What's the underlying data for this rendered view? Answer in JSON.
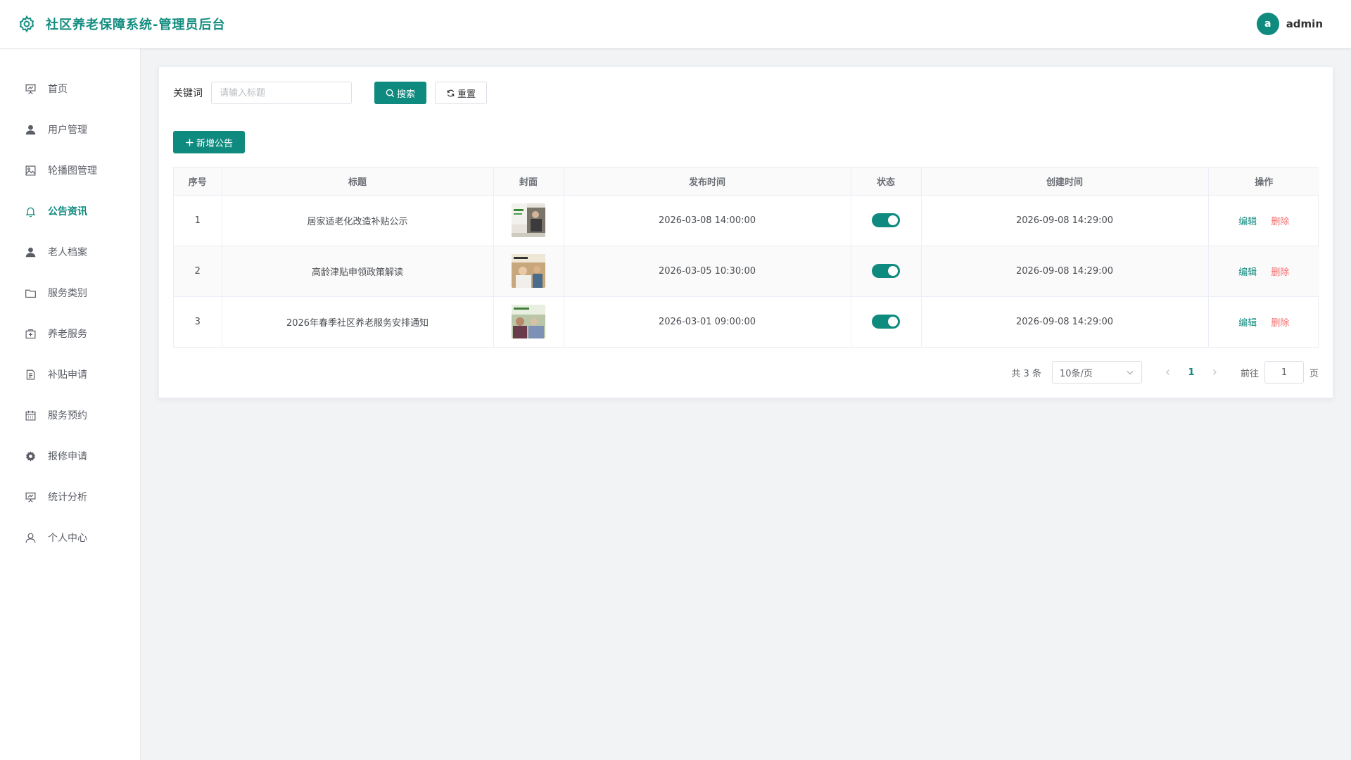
{
  "header": {
    "title": "社区养老保障系统-管理员后台",
    "user": {
      "avatar_letter": "a",
      "name": "admin"
    }
  },
  "sidebar": {
    "items": [
      {
        "label": "首页",
        "icon": "presentation-icon"
      },
      {
        "label": "用户管理",
        "icon": "user-icon"
      },
      {
        "label": "轮播图管理",
        "icon": "picture-icon"
      },
      {
        "label": "公告资讯",
        "icon": "bell-icon",
        "active": true
      },
      {
        "label": "老人档案",
        "icon": "user-icon"
      },
      {
        "label": "服务类别",
        "icon": "folder-icon"
      },
      {
        "label": "养老服务",
        "icon": "first-aid-icon"
      },
      {
        "label": "补贴申请",
        "icon": "document-icon"
      },
      {
        "label": "服务预约",
        "icon": "calendar-icon"
      },
      {
        "label": "报修申请",
        "icon": "gear-icon"
      },
      {
        "label": "统计分析",
        "icon": "presentation-icon"
      },
      {
        "label": "个人中心",
        "icon": "user-outline-icon"
      }
    ]
  },
  "search": {
    "label": "关键词",
    "placeholder": "请输入标题",
    "value": "",
    "search_button": "搜索",
    "reset_button": "重置"
  },
  "add_button": "新增公告",
  "table": {
    "columns": [
      "序号",
      "标题",
      "封面",
      "发布时间",
      "状态",
      "创建时间",
      "操作"
    ],
    "rows": [
      {
        "index": "1",
        "title": "居家适老化改造补贴公示",
        "publish_time": "2026-03-08 14:00:00",
        "status_on": true,
        "created_time": "2026-09-08 14:29:00"
      },
      {
        "index": "2",
        "title": "高龄津贴申领政策解读",
        "publish_time": "2026-03-05 10:30:00",
        "status_on": true,
        "created_time": "2026-09-08 14:29:00"
      },
      {
        "index": "3",
        "title": "2026年春季社区养老服务安排通知",
        "publish_time": "2026-03-01 09:00:00",
        "status_on": true,
        "created_time": "2026-09-08 14:29:00"
      }
    ],
    "actions": {
      "edit": "编辑",
      "delete": "删除"
    }
  },
  "pagination": {
    "total_text": "共 3 条",
    "page_size": "10条/页",
    "current_page": "1",
    "goto_label": "前往",
    "goto_value": "1",
    "goto_unit": "页"
  },
  "colors": {
    "primary": "#0e8a7e",
    "danger": "#f56c6c",
    "background": "#f2f3f5"
  }
}
